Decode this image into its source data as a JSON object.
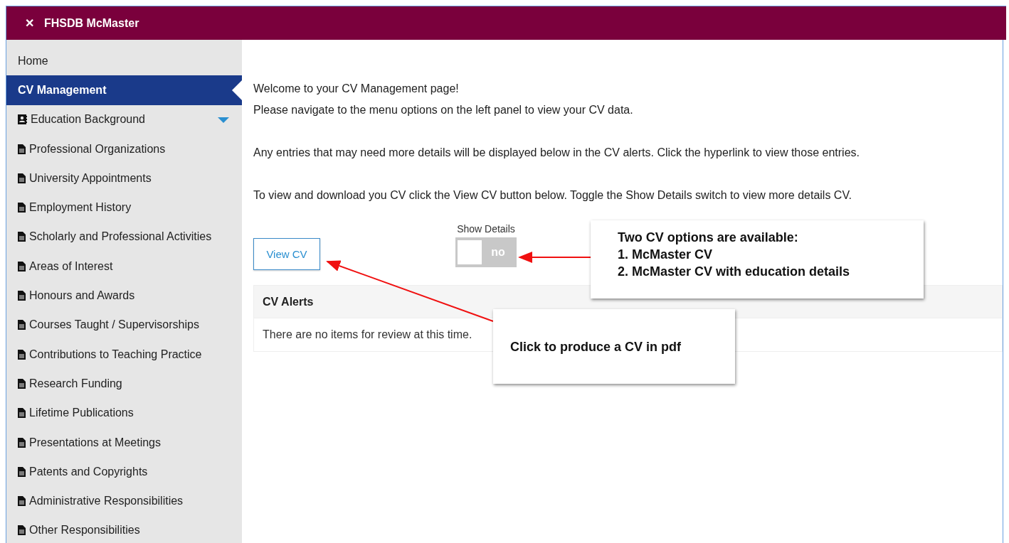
{
  "window": {
    "title": "FHSDB McMaster",
    "close_symbol": "✕"
  },
  "sidebar": {
    "items": [
      {
        "label": "Home",
        "kind": "plain",
        "selected": false,
        "caret": false
      },
      {
        "label": "CV Management",
        "kind": "plain",
        "selected": true,
        "caret": false
      },
      {
        "label": "Education Background",
        "kind": "card",
        "selected": false,
        "caret": true
      },
      {
        "label": "Professional Organizations",
        "kind": "doc",
        "selected": false,
        "caret": false
      },
      {
        "label": "University Appointments",
        "kind": "doc",
        "selected": false,
        "caret": false
      },
      {
        "label": "Employment History",
        "kind": "doc",
        "selected": false,
        "caret": false
      },
      {
        "label": "Scholarly and Professional Activities",
        "kind": "doc",
        "selected": false,
        "caret": false
      },
      {
        "label": "Areas of Interest",
        "kind": "doc",
        "selected": false,
        "caret": false
      },
      {
        "label": "Honours and Awards",
        "kind": "doc",
        "selected": false,
        "caret": false
      },
      {
        "label": "Courses Taught / Supervisorships",
        "kind": "doc",
        "selected": false,
        "caret": false
      },
      {
        "label": "Contributions to Teaching Practice",
        "kind": "doc",
        "selected": false,
        "caret": false
      },
      {
        "label": "Research Funding",
        "kind": "doc",
        "selected": false,
        "caret": false
      },
      {
        "label": "Lifetime Publications",
        "kind": "doc",
        "selected": false,
        "caret": false
      },
      {
        "label": "Presentations at Meetings",
        "kind": "doc",
        "selected": false,
        "caret": false
      },
      {
        "label": "Patents and Copyrights",
        "kind": "doc",
        "selected": false,
        "caret": false
      },
      {
        "label": "Administrative Responsibilities",
        "kind": "doc",
        "selected": false,
        "caret": false
      },
      {
        "label": "Other Responsibilities",
        "kind": "doc",
        "selected": false,
        "caret": false
      }
    ]
  },
  "main": {
    "intro": [
      "Welcome to your CV Management page!",
      "Please navigate to the menu options on the left panel to view your CV data."
    ],
    "alerts_note": "Any entries that may need more details will be displayed below in the CV alerts. Click the hyperlink to view those entries.",
    "view_note": "To view and download you CV click the View CV button below. Toggle the Show Details switch to view more details CV.",
    "view_button": "View CV",
    "show_details": {
      "label": "Show Details",
      "on": false,
      "state_text": "no"
    },
    "alerts": {
      "title": "CV Alerts",
      "message": "There are no items for review at this time."
    }
  },
  "callouts": [
    {
      "lines": [
        "Two CV options are available:",
        "1. McMaster CV",
        "2. McMaster CV with education details"
      ]
    },
    {
      "lines": [
        "Click to produce a CV in pdf"
      ]
    }
  ]
}
